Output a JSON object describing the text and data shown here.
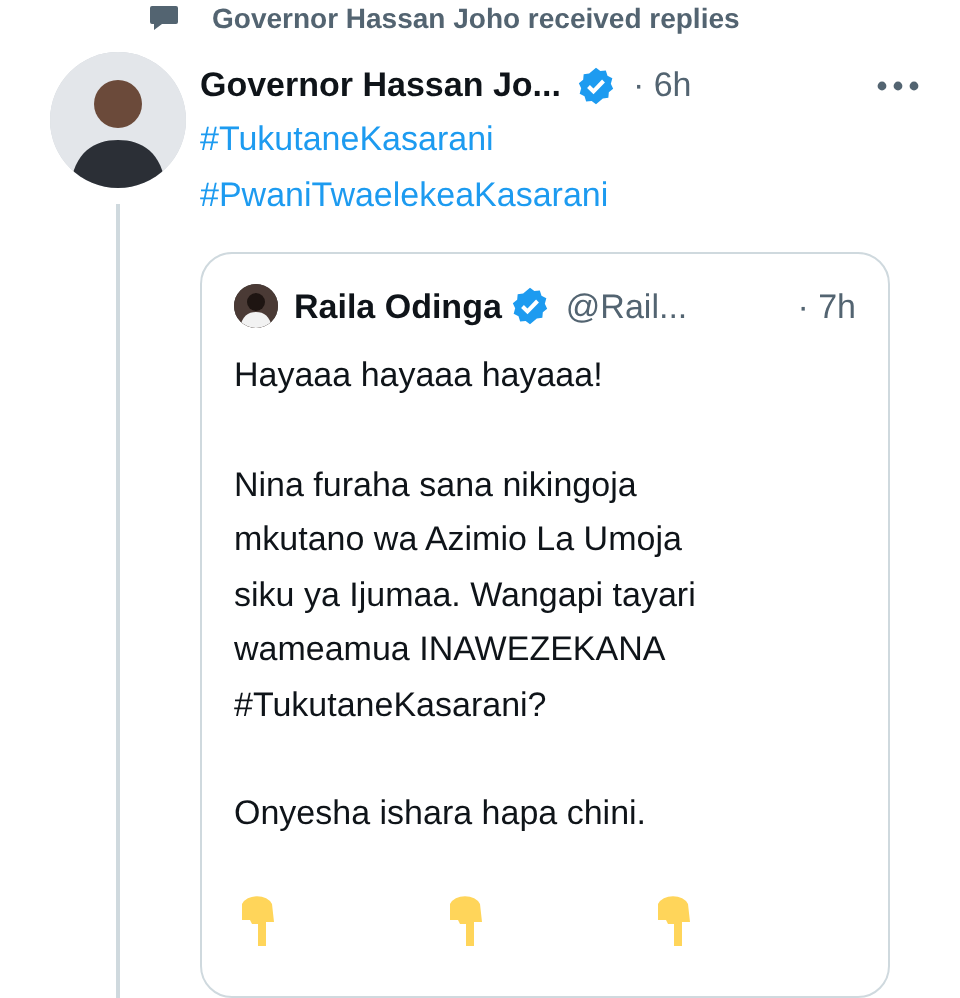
{
  "context": {
    "text": "Governor Hassan Joho received replies"
  },
  "tweet": {
    "author": "Governor Hassan Jo...",
    "verified": true,
    "time": "· 6h",
    "hashtags": [
      "#TukutaneKasarani",
      "#PwaniTwaelekeaKasarani"
    ],
    "quote": {
      "author": "Raila Odinga",
      "verified": true,
      "handle": "@Rail...",
      "time": "· 7h",
      "paragraphs": [
        "Hayaaa hayaaa hayaaa!",
        "Nina furaha sana nikingoja\nmkutano wa Azimio La Umoja\nsiku ya Ijumaa. Wangapi tayari\nwameamua INAWEZEKANA\n#TukutaneKasarani?",
        "Onyesha ishara hapa chini."
      ],
      "emojis": [
        {
          "kind": "point-down"
        },
        {
          "kind": "point-down"
        },
        {
          "kind": "point-down"
        }
      ]
    }
  }
}
